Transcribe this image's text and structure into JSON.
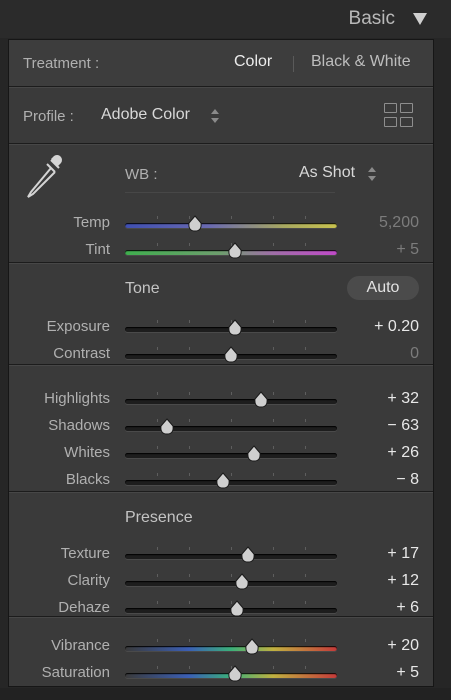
{
  "header": {
    "title": "Basic",
    "collapse_icon": "triangle-down-icon"
  },
  "treatment": {
    "label": "Treatment :",
    "options": [
      "Color",
      "Black & White"
    ],
    "selected": "Color"
  },
  "profile": {
    "label": "Profile :",
    "value": "Adobe Color",
    "browser_icon": "grid-icon"
  },
  "wb": {
    "eyedropper_icon": "eyedropper-icon",
    "label": "WB :",
    "value": "As Shot"
  },
  "tone": {
    "heading": "Tone",
    "auto_label": "Auto"
  },
  "presence": {
    "heading": "Presence"
  },
  "sliders": [
    {
      "id": "temp",
      "label": "Temp",
      "value": "5,200",
      "position": 0.33,
      "gradient": "temp",
      "dim": true
    },
    {
      "id": "tint",
      "label": "Tint",
      "value": "+ 5",
      "position": 0.52,
      "gradient": "tint",
      "dim": true
    },
    {
      "id": "exposure",
      "label": "Exposure",
      "value": "+ 0.20",
      "position": 0.52,
      "gradient": "gray",
      "dim": false
    },
    {
      "id": "contrast",
      "label": "Contrast",
      "value": "0",
      "position": 0.5,
      "gradient": "gray",
      "dim": true
    },
    {
      "id": "highlights",
      "label": "Highlights",
      "value": "+ 32",
      "position": 0.64,
      "gradient": "gray",
      "dim": false
    },
    {
      "id": "shadows",
      "label": "Shadows",
      "value": "− 63",
      "position": 0.2,
      "gradient": "gray",
      "dim": false
    },
    {
      "id": "whites",
      "label": "Whites",
      "value": "+ 26",
      "position": 0.61,
      "gradient": "gray",
      "dim": false
    },
    {
      "id": "blacks",
      "label": "Blacks",
      "value": "− 8",
      "position": 0.46,
      "gradient": "gray",
      "dim": false
    },
    {
      "id": "texture",
      "label": "Texture",
      "value": "+ 17",
      "position": 0.58,
      "gradient": "gray",
      "dim": false
    },
    {
      "id": "clarity",
      "label": "Clarity",
      "value": "+ 12",
      "position": 0.55,
      "gradient": "gray",
      "dim": false
    },
    {
      "id": "dehaze",
      "label": "Dehaze",
      "value": "+ 6",
      "position": 0.53,
      "gradient": "gray",
      "dim": false
    },
    {
      "id": "vibrance",
      "label": "Vibrance",
      "value": "+ 20",
      "position": 0.6,
      "gradient": "spectrum",
      "dim": false
    },
    {
      "id": "saturation",
      "label": "Saturation",
      "value": "+ 5",
      "position": 0.52,
      "gradient": "spectrum",
      "dim": false
    }
  ],
  "colors": {
    "value_bright": "#e8e8e8",
    "value_dim": "#7c7c7c",
    "thumb": "#cfcfcf"
  }
}
